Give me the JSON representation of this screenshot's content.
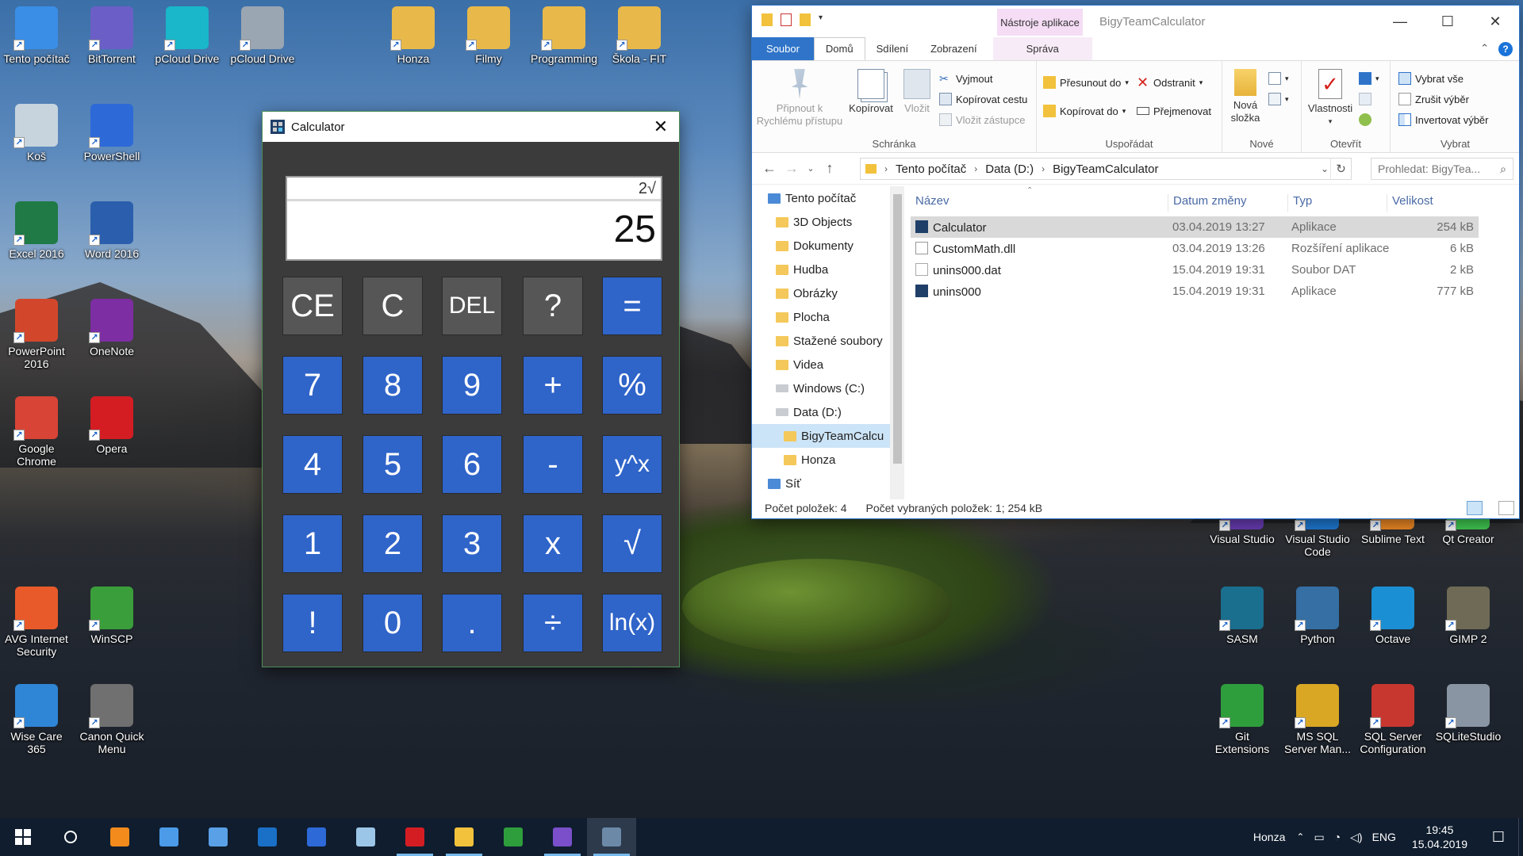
{
  "desktop": {
    "icons": [
      {
        "label": "Tento počítač",
        "glyph": "computer-icon",
        "color": "#3a8ee6"
      },
      {
        "label": "BitTorrent",
        "glyph": "bittorrent-icon",
        "color": "#6b5fc7"
      },
      {
        "label": "pCloud Drive",
        "glyph": "pcloud-icon",
        "color": "#19b7c9"
      },
      {
        "label": "pCloud Drive",
        "glyph": "drive-help-icon",
        "color": "#9aa6b2"
      },
      {
        "label": "Honza",
        "glyph": "folder-icon",
        "color": "#e8b94a"
      },
      {
        "label": "Filmy",
        "glyph": "folder-icon",
        "color": "#e8b94a"
      },
      {
        "label": "Programming",
        "glyph": "folder-icon",
        "color": "#e8b94a"
      },
      {
        "label": "Škola - FIT",
        "glyph": "folder-icon",
        "color": "#e8b94a"
      },
      {
        "label": "Koš",
        "glyph": "recycle-bin-icon",
        "color": "#c7d4de"
      },
      {
        "label": "PowerShell",
        "glyph": "powershell-icon",
        "color": "#2d6ad8"
      },
      {
        "label": "Excel 2016",
        "glyph": "excel-icon",
        "color": "#1f7a45"
      },
      {
        "label": "Word 2016",
        "glyph": "word-icon",
        "color": "#2b5fad"
      },
      {
        "label": "PowerPoint 2016",
        "glyph": "powerpoint-icon",
        "color": "#d2472b"
      },
      {
        "label": "OneNote",
        "glyph": "onenote-icon",
        "color": "#7d2ea3"
      },
      {
        "label": "Google Chrome",
        "glyph": "chrome-icon",
        "color": "#d84436"
      },
      {
        "label": "Opera",
        "glyph": "opera-icon",
        "color": "#d41d23"
      },
      {
        "label": "AVG Internet Security",
        "glyph": "avg-icon",
        "color": "#e85a2a"
      },
      {
        "label": "WinSCP",
        "glyph": "winscp-icon",
        "color": "#3a9e3a"
      },
      {
        "label": "Wise Care 365",
        "glyph": "wisecare-icon",
        "color": "#2f86d6"
      },
      {
        "label": "Canon Quick Menu",
        "glyph": "canon-icon",
        "color": "#707070"
      },
      {
        "label": "Visual Studio",
        "glyph": "visual-studio-icon",
        "color": "#6a3db6"
      },
      {
        "label": "Visual Studio Code",
        "glyph": "vscode-icon",
        "color": "#1e7ad6"
      },
      {
        "label": "Sublime Text",
        "glyph": "sublime-icon",
        "color": "#f08a24"
      },
      {
        "label": "Qt Creator",
        "glyph": "qt-icon",
        "color": "#41cd52"
      },
      {
        "label": "SASM",
        "glyph": "sasm-icon",
        "color": "#1a6e8e"
      },
      {
        "label": "Python",
        "glyph": "python-icon",
        "color": "#356fa3"
      },
      {
        "label": "Octave",
        "glyph": "octave-icon",
        "color": "#1b8fd4"
      },
      {
        "label": "GIMP 2",
        "glyph": "gimp-icon",
        "color": "#6f6a55"
      },
      {
        "label": "Git Extensions",
        "glyph": "git-extensions-icon",
        "color": "#2e9e3c"
      },
      {
        "label": "MS SQL Server Man...",
        "glyph": "ssms-icon",
        "color": "#d9a724"
      },
      {
        "label": "SQL Server Configuration",
        "glyph": "sql-config-icon",
        "color": "#c8372f"
      },
      {
        "label": "SQLiteStudio",
        "glyph": "sqlitestudio-icon",
        "color": "#8a95a3"
      }
    ]
  },
  "calculator": {
    "title": "Calculator",
    "expression": "2√",
    "result": "25",
    "keys": [
      {
        "label": "CE",
        "style": "dark"
      },
      {
        "label": "C",
        "style": "dark"
      },
      {
        "label": "DEL",
        "style": "dark"
      },
      {
        "label": "?",
        "style": "dark"
      },
      {
        "label": "=",
        "style": "blue"
      },
      {
        "label": "7",
        "style": "blue"
      },
      {
        "label": "8",
        "style": "blue"
      },
      {
        "label": "9",
        "style": "blue"
      },
      {
        "label": "+",
        "style": "blue"
      },
      {
        "label": "%",
        "style": "blue"
      },
      {
        "label": "4",
        "style": "blue"
      },
      {
        "label": "5",
        "style": "blue"
      },
      {
        "label": "6",
        "style": "blue"
      },
      {
        "label": "-",
        "style": "blue"
      },
      {
        "label": "y^x",
        "style": "blue"
      },
      {
        "label": "1",
        "style": "blue"
      },
      {
        "label": "2",
        "style": "blue"
      },
      {
        "label": "3",
        "style": "blue"
      },
      {
        "label": "x",
        "style": "blue"
      },
      {
        "label": "√",
        "style": "blue"
      },
      {
        "label": "!",
        "style": "blue"
      },
      {
        "label": "0",
        "style": "blue"
      },
      {
        "label": ".",
        "style": "blue"
      },
      {
        "label": "÷",
        "style": "blue"
      },
      {
        "label": "ln(x)",
        "style": "blue"
      }
    ]
  },
  "explorer": {
    "context_tab": "Nástroje aplikace",
    "window_title": "BigyTeamCalculator",
    "tabs": {
      "file": "Soubor",
      "home": "Domů",
      "share": "Sdílení",
      "view": "Zobrazení",
      "manage": "Správa"
    },
    "ribbon": {
      "clipboard": {
        "pin": "Připnout k Rychlému přístupu",
        "copy": "Kopírovat",
        "paste": "Vložit",
        "cut": "Vyjmout",
        "copy_path": "Kopírovat cestu",
        "paste_shortcut": "Vložit zástupce",
        "group": "Schránka"
      },
      "organize": {
        "move_to": "Přesunout do",
        "copy_to": "Kopírovat do",
        "delete": "Odstranit",
        "rename": "Přejmenovat",
        "group": "Uspořádat"
      },
      "new": {
        "new_folder": "Nová složka",
        "group": "Nové"
      },
      "open": {
        "properties": "Vlastnosti",
        "group": "Otevřít"
      },
      "select": {
        "select_all": "Vybrat vše",
        "select_none": "Zrušit výběr",
        "invert": "Invertovat výběr",
        "group": "Vybrat"
      }
    },
    "address": {
      "crumbs": [
        "Tento počítač",
        "Data (D:)",
        "BigyTeamCalculator"
      ],
      "search_placeholder": "Prohledat: BigyTea..."
    },
    "nav": [
      {
        "label": "Tento počítač",
        "kind": "pc",
        "indent": 0
      },
      {
        "label": "3D Objects",
        "kind": "folder",
        "indent": 1
      },
      {
        "label": "Dokumenty",
        "kind": "folder",
        "indent": 1
      },
      {
        "label": "Hudba",
        "kind": "folder",
        "indent": 1
      },
      {
        "label": "Obrázky",
        "kind": "folder",
        "indent": 1
      },
      {
        "label": "Plocha",
        "kind": "folder",
        "indent": 1
      },
      {
        "label": "Stažené soubory",
        "kind": "folder",
        "indent": 1
      },
      {
        "label": "Videa",
        "kind": "folder",
        "indent": 1
      },
      {
        "label": "Windows (C:)",
        "kind": "drive",
        "indent": 1
      },
      {
        "label": "Data (D:)",
        "kind": "drive",
        "indent": 1
      },
      {
        "label": "BigyTeamCalcu",
        "kind": "folder",
        "indent": 2,
        "selected": true
      },
      {
        "label": "Honza",
        "kind": "folder",
        "indent": 2
      },
      {
        "label": "Síť",
        "kind": "pc",
        "indent": 0
      }
    ],
    "columns": {
      "name": "Název",
      "date": "Datum změny",
      "type": "Typ",
      "size": "Velikost"
    },
    "files": [
      {
        "name": "Calculator",
        "date": "03.04.2019 13:27",
        "type": "Aplikace",
        "size": "254 kB",
        "icon": "app",
        "selected": true
      },
      {
        "name": "CustomMath.dll",
        "date": "03.04.2019 13:26",
        "type": "Rozšíření aplikace",
        "size": "6 kB",
        "icon": "dll"
      },
      {
        "name": "unins000.dat",
        "date": "15.04.2019 19:31",
        "type": "Soubor DAT",
        "size": "2 kB",
        "icon": "dat"
      },
      {
        "name": "unins000",
        "date": "15.04.2019 19:31",
        "type": "Aplikace",
        "size": "777 kB",
        "icon": "app"
      }
    ],
    "status": {
      "count": "Počet položek: 4",
      "selected": "Počet vybraných položek: 1; 254 kB"
    }
  },
  "taskbar": {
    "user": "Honza",
    "language": "ENG",
    "time": "19:45",
    "date": "15.04.2019",
    "items": [
      {
        "name": "search-button",
        "color": "#ffffff"
      },
      {
        "name": "cortana-icon",
        "color": "#f28b1c"
      },
      {
        "name": "this-pc-icon",
        "color": "#4b9be8"
      },
      {
        "name": "control-panel-icon",
        "color": "#5aa0e6"
      },
      {
        "name": "outlook-icon",
        "color": "#1a6fc6"
      },
      {
        "name": "powershell-icon",
        "color": "#2d6ad8"
      },
      {
        "name": "ssms-icon",
        "color": "#9cc6e8"
      },
      {
        "name": "opera-icon",
        "color": "#d41d23",
        "running": true
      },
      {
        "name": "file-explorer-icon",
        "color": "#f2c23c",
        "running": true
      },
      {
        "name": "git-extensions-icon",
        "color": "#2e9e3c"
      },
      {
        "name": "visual-studio-icon",
        "color": "#7a4fc9",
        "running": true
      },
      {
        "name": "calculator-icon",
        "color": "#6c8aa8",
        "running": true,
        "active": true
      }
    ]
  }
}
